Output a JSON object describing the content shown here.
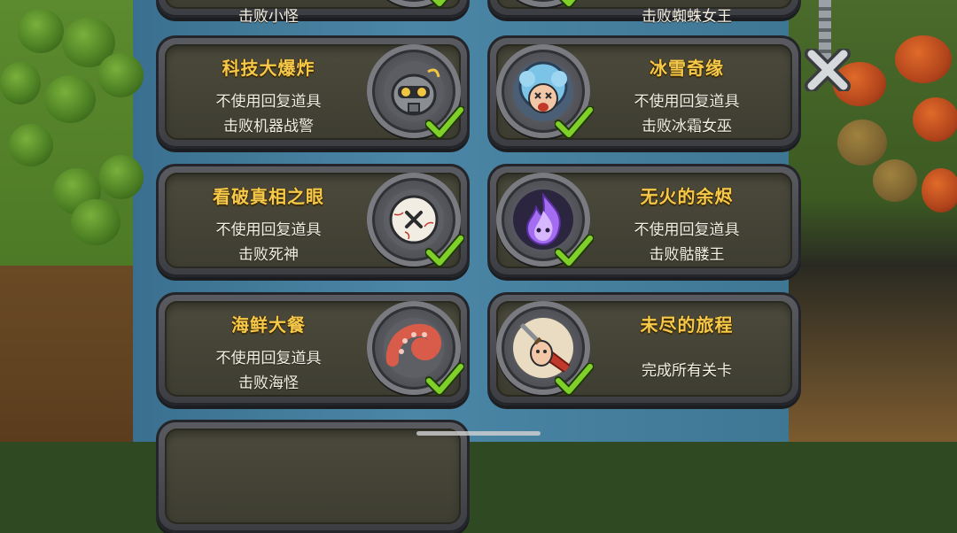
{
  "screen": "achievements",
  "top_partial": {
    "left_desc": "击败小怪",
    "right_desc": "击败蜘蛛女王"
  },
  "achievements": [
    {
      "title": "科技大爆炸",
      "lines": [
        "不使用回复道具",
        "击败机器战警"
      ],
      "icon": "robot-icon",
      "completed": true
    },
    {
      "title": "冰雪奇缘",
      "lines": [
        "不使用回复道具",
        "击败冰霜女巫"
      ],
      "icon": "ice-witch-icon",
      "completed": true
    },
    {
      "title": "看破真相之眼",
      "lines": [
        "不使用回复道具",
        "击败死神"
      ],
      "icon": "eyeball-icon",
      "completed": true
    },
    {
      "title": "无火的余烬",
      "lines": [
        "不使用回复道具",
        "击败骷髅王"
      ],
      "icon": "purple-flame-icon",
      "completed": true
    },
    {
      "title": "海鲜大餐",
      "lines": [
        "不使用回复道具",
        "击败海怪"
      ],
      "icon": "tentacle-icon",
      "completed": true
    },
    {
      "title": "未尽的旅程",
      "lines": [
        "完成所有关卡"
      ],
      "icon": "hero-sword-icon",
      "completed": true
    }
  ],
  "close_button": {
    "icon": "close-icon"
  },
  "colors": {
    "title": "#f6c94a",
    "desc": "#f3efe2",
    "check": "#7fd12a",
    "panel": "#3e3d31"
  }
}
